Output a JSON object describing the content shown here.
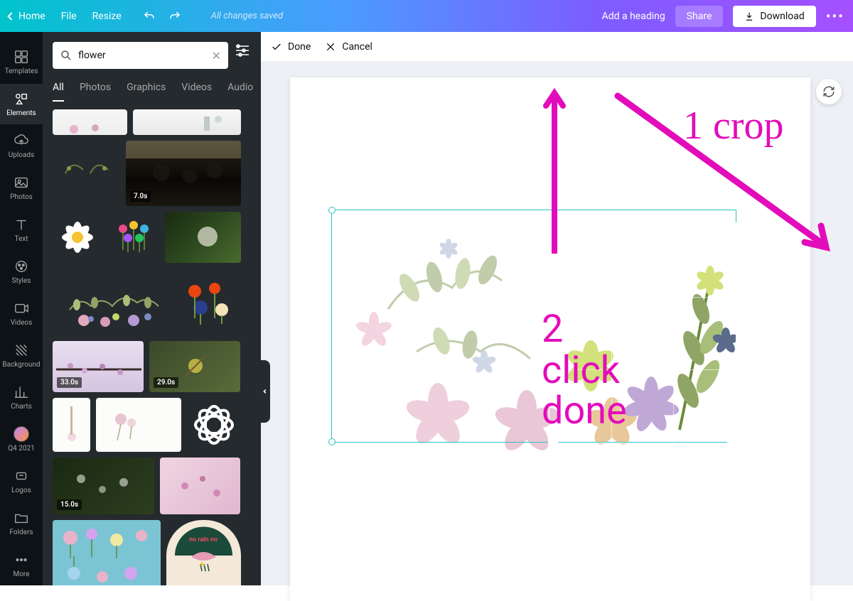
{
  "topbar": {
    "home": "Home",
    "file": "File",
    "resize": "Resize",
    "saved": "All changes saved",
    "add_heading": "Add a heading",
    "share": "Share",
    "download": "Download"
  },
  "rail": {
    "templates": "Templates",
    "elements": "Elements",
    "uploads": "Uploads",
    "photos": "Photos",
    "text": "Text",
    "styles": "Styles",
    "videos": "Videos",
    "background": "Background",
    "charts": "Charts",
    "q4": "Q4 2021",
    "logos": "Logos",
    "folders": "Folders",
    "more": "More"
  },
  "search": {
    "value": "flower",
    "placeholder": "Search"
  },
  "tabs": {
    "all": "All",
    "photos": "Photos",
    "graphics": "Graphics",
    "videos": "Videos",
    "audio": "Audio"
  },
  "durations": {
    "d1": "7.0s",
    "d2": "33.0s",
    "d3": "29.0s",
    "d4": "15.0s"
  },
  "cropbar": {
    "done": "Done",
    "cancel": "Cancel"
  },
  "annotations": {
    "a1": "1 crop",
    "a2_l1": "2",
    "a2_l2": "click",
    "a2_l3": "done"
  }
}
